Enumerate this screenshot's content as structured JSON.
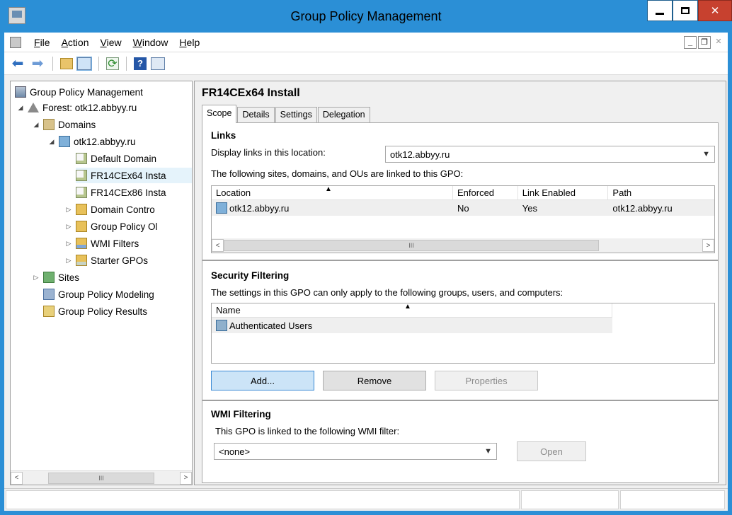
{
  "window": {
    "title": "Group Policy Management"
  },
  "menubar": {
    "items": [
      "File",
      "Action",
      "View",
      "Window",
      "Help"
    ]
  },
  "tree": {
    "items": [
      {
        "label": "Group Policy Management",
        "icon": "gpm-console-icon"
      },
      {
        "label": "Forest: otk12.abbyy.ru",
        "icon": "forest-icon"
      },
      {
        "label": "Domains",
        "icon": "domains-icon"
      },
      {
        "label": "otk12.abbyy.ru",
        "icon": "domain-icon"
      },
      {
        "label": "Default Domain",
        "icon": "gpo-link-icon"
      },
      {
        "label": "FR14CEx64 Insta",
        "icon": "gpo-link-icon"
      },
      {
        "label": "FR14CEx86 Insta",
        "icon": "gpo-link-icon"
      },
      {
        "label": "Domain Contro",
        "icon": "ou-folder-icon"
      },
      {
        "label": "Group Policy Ol",
        "icon": "gpo-folder-icon"
      },
      {
        "label": "WMI Filters",
        "icon": "wmi-folder-icon"
      },
      {
        "label": "Starter GPOs",
        "icon": "starter-folder-icon"
      },
      {
        "label": "Sites",
        "icon": "sites-icon"
      },
      {
        "label": "Group Policy Modeling",
        "icon": "modeling-icon"
      },
      {
        "label": "Group Policy Results",
        "icon": "results-icon"
      }
    ],
    "scroll_label": "III"
  },
  "details": {
    "gpo_title": "FR14CEx64 Install",
    "tabs": [
      "Scope",
      "Details",
      "Settings",
      "Delegation"
    ],
    "links": {
      "heading": "Links",
      "display_label": "Display links in this location:",
      "location_value": "otk12.abbyy.ru",
      "description": "The following sites, domains, and OUs are linked to this GPO:",
      "columns": [
        "Location",
        "Enforced",
        "Link Enabled",
        "Path"
      ],
      "rows": [
        {
          "location": "otk12.abbyy.ru",
          "enforced": "No",
          "link_enabled": "Yes",
          "path": "otk12.abbyy.ru"
        }
      ],
      "scroll_label": "III"
    },
    "security": {
      "heading": "Security Filtering",
      "description": "The settings in this GPO can only apply to the following groups, users, and computers:",
      "column": "Name",
      "rows": [
        "Authenticated Users"
      ],
      "add_label": "Add...",
      "remove_label": "Remove",
      "properties_label": "Properties"
    },
    "wmi": {
      "heading": "WMI Filtering",
      "description": "This GPO is linked to the following WMI filter:",
      "filter_value": "<none>",
      "open_label": "Open"
    }
  }
}
